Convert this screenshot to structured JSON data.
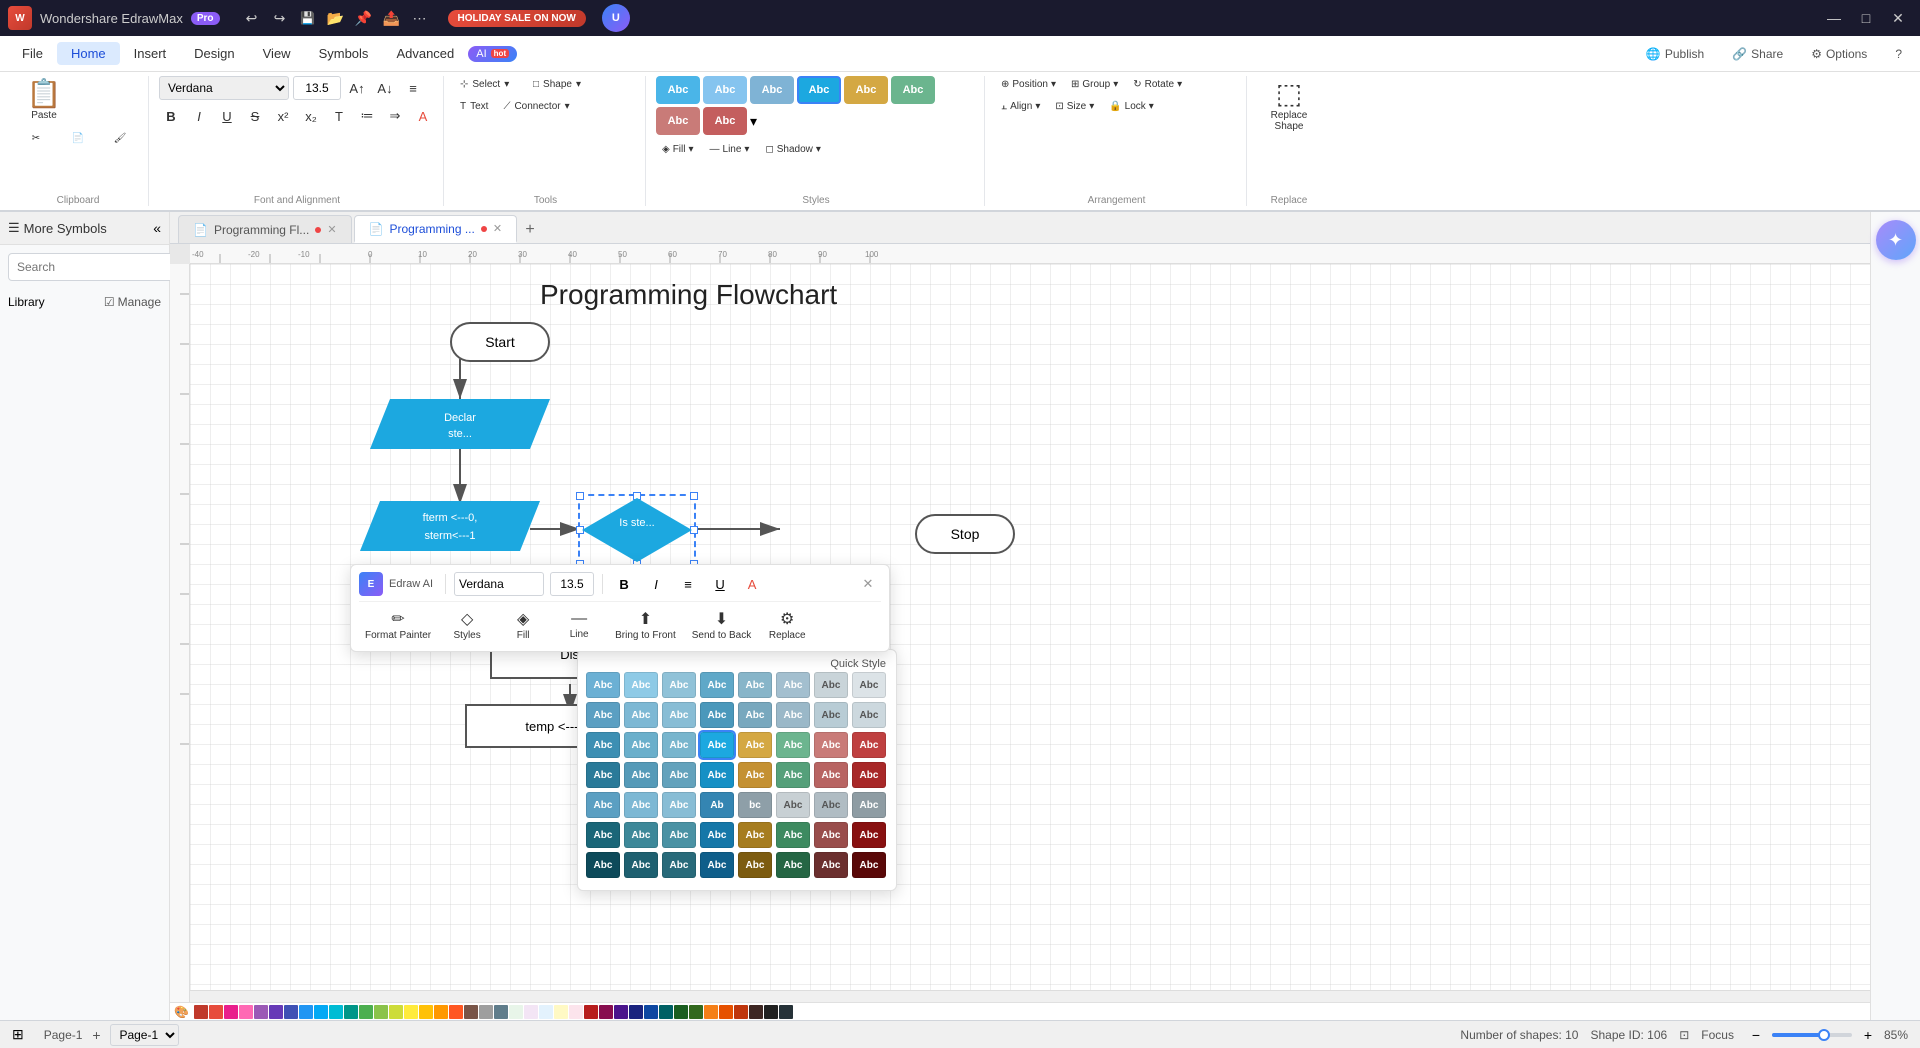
{
  "app": {
    "name": "Wondershare EdrawMax",
    "pro_label": "Pro",
    "title_bar": {
      "undo_icon": "↩",
      "redo_icon": "↪",
      "save_icon": "💾",
      "open_icon": "📂",
      "pin_icon": "📌",
      "share_icon": "📤",
      "more_icon": "⋯",
      "holiday_label": "HOLIDAY SALE ON NOW",
      "minimize": "—",
      "maximize": "□",
      "close": "✕"
    }
  },
  "menu": {
    "items": [
      "File",
      "Home",
      "Insert",
      "Design",
      "View",
      "Symbols",
      "Advanced"
    ],
    "active_index": 1,
    "right_buttons": [
      "Publish",
      "Share",
      "Options",
      "?"
    ],
    "ai_label": "AI",
    "hot_label": "hot"
  },
  "toolbar": {
    "clipboard_label": "Clipboard",
    "font_label": "Font and Alignment",
    "tools_label": "Tools",
    "styles_label": "Styles",
    "arrangement_label": "Arrangement",
    "replace_label": "Replace",
    "font_name": "Verdana",
    "font_size": "13.5",
    "select_label": "Select",
    "shape_label": "Shape",
    "text_label": "Text",
    "connector_label": "Connector",
    "fill_label": "Fill",
    "line_label": "Line",
    "shadow_label": "Shadow",
    "position_label": "Position",
    "group_label": "Group",
    "rotate_label": "Rotate",
    "align_label": "Align",
    "size_label": "Size",
    "lock_label": "Lock",
    "replace_shape_label": "Replace Shape",
    "style_chips": [
      {
        "color": "#4ab5e8",
        "text": "Abc"
      },
      {
        "color": "#85c4ef",
        "text": "Abc"
      },
      {
        "color": "#7fb3d5",
        "text": "Abc"
      },
      {
        "color": "#1ca8e0",
        "text": "Abc",
        "selected": true
      },
      {
        "color": "#d4a843",
        "text": "Abc"
      },
      {
        "color": "#6bb58e",
        "text": "Abc"
      },
      {
        "color": "#c97b78",
        "text": "Abc"
      },
      {
        "color": "#c45e5e",
        "text": "Abc"
      }
    ]
  },
  "sidebar": {
    "title": "More Symbols",
    "search_placeholder": "Search",
    "search_btn": "Search",
    "library_label": "Library",
    "manage_label": "Manage"
  },
  "tabs": [
    {
      "label": "Programming Fl...",
      "has_dot": true,
      "active": false
    },
    {
      "label": "Programming ...",
      "has_dot": true,
      "active": true
    }
  ],
  "add_tab_icon": "+",
  "canvas": {
    "diagram_title": "Programming Flowchart",
    "shapes": {
      "start": {
        "label": "Start"
      },
      "declar": {
        "label": "Declar... ste..."
      },
      "fterm": {
        "label": "fterm <---0, sterm<---1"
      },
      "decision": {
        "label": "Is ste..."
      },
      "stop": {
        "label": "Stop"
      },
      "display": {
        "label": "Dis..."
      },
      "temp": {
        "label": "temp <--- sterm"
      }
    }
  },
  "floating_toolbar": {
    "font": "Verdana",
    "size": "13.5",
    "edraw_ai_label": "Edraw AI",
    "bold": "B",
    "italic": "I",
    "align": "≡",
    "underline": "U̲",
    "color": "A",
    "tools": [
      {
        "icon": "✏",
        "label": "Format Painter"
      },
      {
        "icon": "◇",
        "label": "Styles"
      },
      {
        "icon": "◈",
        "label": "Fill"
      },
      {
        "icon": "—",
        "label": "Line"
      },
      {
        "icon": "⬆",
        "label": "Bring to Front"
      },
      {
        "icon": "⬇",
        "label": "Send to Back"
      },
      {
        "icon": "⚙",
        "label": "Replace"
      }
    ]
  },
  "quick_style": {
    "label": "Quick Style",
    "rows": [
      [
        {
          "color": "#6bb0d4",
          "text": "Abc"
        },
        {
          "color": "#8ecae6",
          "text": "Abc"
        },
        {
          "color": "#90c2d8",
          "text": "Abc"
        },
        {
          "color": "#5fa8c8",
          "text": "Abc"
        },
        {
          "color": "#87b5c9",
          "text": "Abc"
        },
        {
          "color": "#a3bfcf",
          "text": "Abc"
        },
        {
          "color": "#c9d4d9",
          "text": "Abc"
        },
        {
          "color": "#dce3e7",
          "text": "Abc"
        }
      ],
      [
        {
          "color": "#5b9fc2",
          "text": "Abc"
        },
        {
          "color": "#7db8d4",
          "text": "Abc"
        },
        {
          "color": "#88bdd5",
          "text": "Abc"
        },
        {
          "color": "#4a98bb",
          "text": "Abc"
        },
        {
          "color": "#78a8be",
          "text": "Abc"
        },
        {
          "color": "#9ab8c8",
          "text": "Abc"
        },
        {
          "color": "#b8ccd5",
          "text": "Abc"
        },
        {
          "color": "#ccd8de",
          "text": "Abc"
        }
      ],
      [
        {
          "color": "#3d8fb3",
          "text": "Abc"
        },
        {
          "color": "#6aafcb",
          "text": "Abc"
        },
        {
          "color": "#78b5cd",
          "text": "Abc"
        },
        {
          "color": "#1ca8e0",
          "text": "Abc",
          "selected": true
        },
        {
          "color": "#d4a843",
          "text": "Abc"
        },
        {
          "color": "#6cb58f",
          "text": "Abc"
        },
        {
          "color": "#c97b78",
          "text": "Abc"
        },
        {
          "color": "#bf4040",
          "text": "Abc"
        }
      ],
      [
        {
          "color": "#2a7a99",
          "text": "Abc"
        },
        {
          "color": "#559ab8",
          "text": "Abc"
        },
        {
          "color": "#63a2bc",
          "text": "Abc"
        },
        {
          "color": "#1690c5",
          "text": "Abc"
        },
        {
          "color": "#c49133",
          "text": "Abc"
        },
        {
          "color": "#55a07a",
          "text": "Abc"
        },
        {
          "color": "#b86462",
          "text": "Abc"
        },
        {
          "color": "#a82828",
          "text": "Abc"
        }
      ],
      [
        {
          "color": "#5b9fc2",
          "text": "Abc"
        },
        {
          "color": "#7db8d4",
          "text": "Abc"
        },
        {
          "color": "#88bdd5",
          "text": "Abc"
        },
        {
          "color": "#3485b2",
          "text": "Abc"
        },
        {
          "color": "#3485b2",
          "text": "Ab",
          "sub": true
        },
        {
          "color": "#8e9fa8",
          "text": "bc",
          "sub": true
        },
        {
          "color": "#c8d0d4",
          "text": "Abc"
        },
        {
          "color": "#b0bcc3",
          "text": "Abc"
        }
      ],
      [
        {
          "color": "#1a6678",
          "text": "Abc"
        },
        {
          "color": "#3d8899",
          "text": "Abc"
        },
        {
          "color": "#4a92a4",
          "text": "Abc"
        },
        {
          "color": "#1577a8",
          "text": "Abc"
        },
        {
          "color": "#a67d20",
          "text": "Abc"
        },
        {
          "color": "#3d8a60",
          "text": "Abc"
        },
        {
          "color": "#994d4b",
          "text": "Abc"
        },
        {
          "color": "#881010",
          "text": "Abc"
        }
      ],
      [
        {
          "color": "#0d4a5a",
          "text": "Abc"
        },
        {
          "color": "#1e6070",
          "text": "Abc"
        },
        {
          "color": "#286a7a",
          "text": "Abc"
        },
        {
          "color": "#0f5e8a",
          "text": "Abc"
        },
        {
          "color": "#7d5c10",
          "text": "Abc"
        },
        {
          "color": "#256644",
          "text": "Abc"
        },
        {
          "color": "#6b2f2e",
          "text": "Abc"
        },
        {
          "color": "#5a0808",
          "text": "Abc"
        }
      ]
    ]
  },
  "color_bar": {
    "colors": [
      "#c0392b",
      "#e74c3c",
      "#e91e8c",
      "#9b59b6",
      "#673ab7",
      "#3f51b5",
      "#2196f3",
      "#03a9f4",
      "#00bcd4",
      "#009688",
      "#4caf50",
      "#8bc34a",
      "#cddc39",
      "#ffeb3b",
      "#ffc107",
      "#ff9800",
      "#ff5722",
      "#795548",
      "#9e9e9e",
      "#607d8b",
      "#e8f5e9",
      "#f3e5f5",
      "#e3f2fd",
      "#fff9c4",
      "#fce4ec",
      "#b71c1c",
      "#880e4f",
      "#4a148c",
      "#1a237e",
      "#0d47a1",
      "#006064",
      "#1b5e20",
      "#33691e",
      "#f57f17",
      "#e65100",
      "#bf360c",
      "#3e2723",
      "#212121",
      "#263238"
    ]
  },
  "statusbar": {
    "shapes_count": "Number of shapes: 10",
    "shape_id": "Shape ID: 106",
    "focus_label": "Focus",
    "zoom_percent": "85%",
    "page_label": "Page-1",
    "view_icon": "⊞"
  }
}
